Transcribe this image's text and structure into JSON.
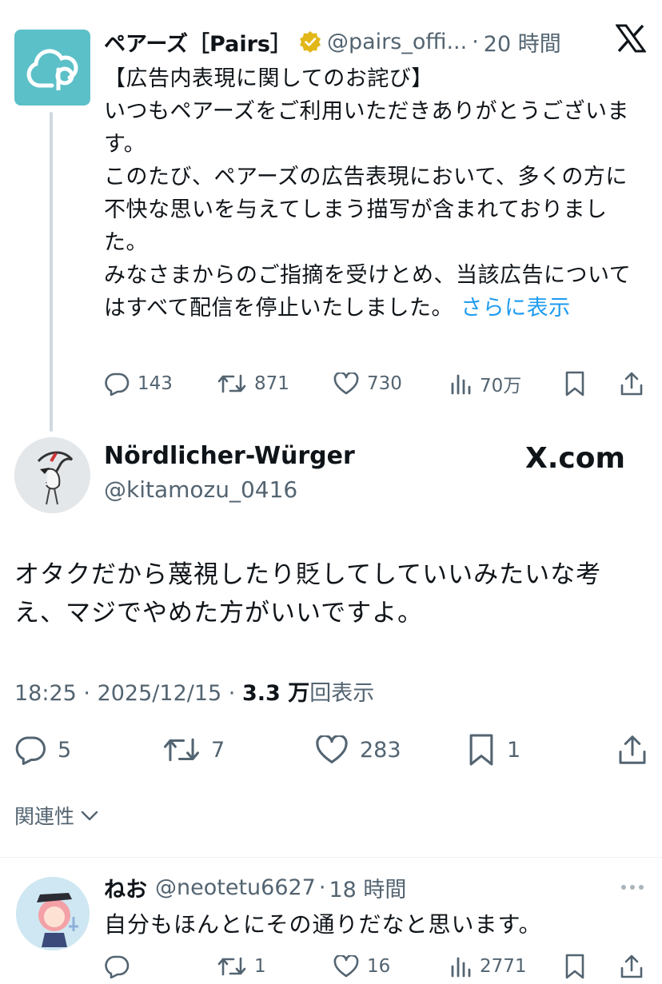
{
  "quoted_tweet": {
    "name": "ペアーズ［Pairs］",
    "handle": "@pairs_offi...",
    "separator": "·",
    "time": "20 時間",
    "body_lines": [
      "【広告内表現に関してのお詫び】",
      "いつもペアーズをご利用いただきありがとうございます。",
      "このたび、ペアーズの広告表現において、多くの方に不快な思いを与えてしまう描写が含まれておりました。",
      "みなさまからのご指摘を受けとめ、当該広告についてはすべて配信を停止いたしました。"
    ],
    "show_more": "さらに表示",
    "stats": {
      "replies": "143",
      "reposts": "871",
      "likes": "730",
      "views": "70万"
    },
    "colors": {
      "logo_bg": "#5bc0c8",
      "verified": "#e2b719"
    }
  },
  "main_tweet": {
    "author_name": "Nördlicher-Würger",
    "author_handle": "@kitamozu_0416",
    "source": "X.com",
    "text": "オタクだから蔑視したり貶してしていいみたいな考え、マジでやめた方がいいですよ。",
    "time": "18:25",
    "date": "2025/12/15",
    "views_count": "3.3 万",
    "views_label": "回表示",
    "stats": {
      "replies": "5",
      "reposts": "7",
      "likes": "283",
      "bookmarks": "1"
    }
  },
  "related_label": "関連性",
  "reply": {
    "name": "ねお",
    "handle": "@neotetu6627",
    "time": "18 時間",
    "text": "自分もほんとにその通りだなと思います。",
    "stats": {
      "replies": "",
      "reposts": "1",
      "likes": "16",
      "views": "2771"
    }
  },
  "colors": {
    "text": "#0f1419",
    "muted": "#536471",
    "link": "#1d9bf0",
    "line": "#cfd9de"
  }
}
